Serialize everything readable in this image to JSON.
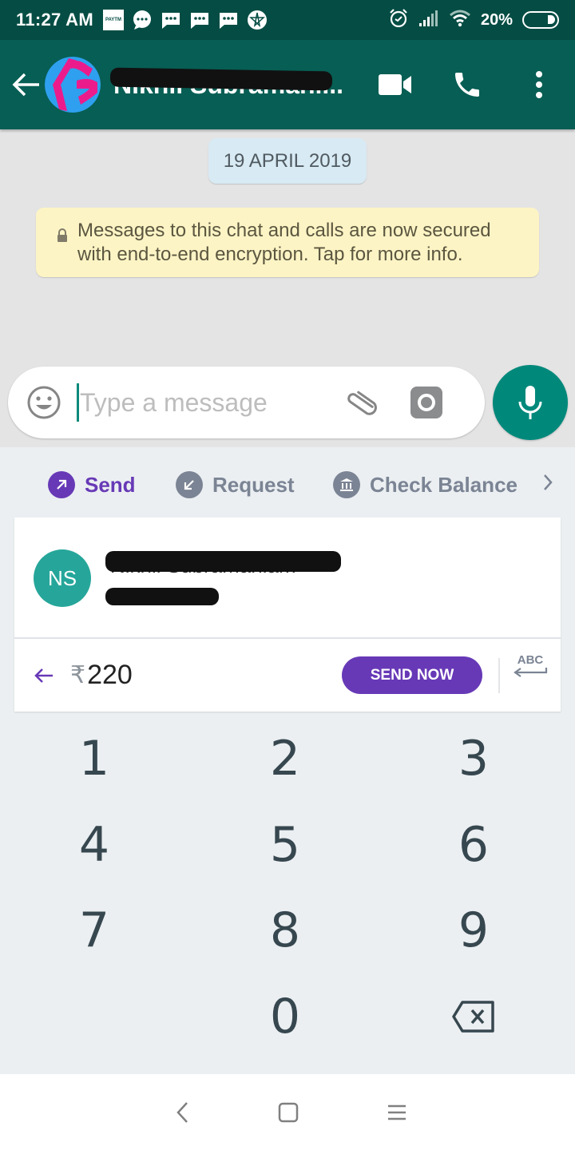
{
  "status_bar": {
    "time": "11:27 AM",
    "notification_icons": [
      "paytm-icon",
      "chat-bubble-icon",
      "message-icon",
      "message-icon",
      "message-icon",
      "star-app-icon"
    ],
    "paytm_label": "PAYTM",
    "battery_percent": "20%",
    "battery_level": 0.2
  },
  "app_bar": {
    "contact_name": "Nikhil Subramani...",
    "contact_name_redacted": true
  },
  "chat": {
    "date_chip": "19 APRIL 2019",
    "encryption_notice": "Messages to this chat and calls are now secured with end-to-end encryption. Tap for more info."
  },
  "composer": {
    "placeholder": "Type a message",
    "value": ""
  },
  "payments": {
    "tabs": [
      {
        "label": "Send",
        "active": true
      },
      {
        "label": "Request",
        "active": false
      },
      {
        "label": "Check Balance",
        "active": false
      }
    ],
    "recipient": {
      "initials": "NS",
      "name": "Nikhil Subramaniam",
      "name_redacted": true,
      "subtitle_redacted": true
    },
    "currency_symbol": "₹",
    "amount": "220",
    "send_now_label": "SEND NOW",
    "keyboard_toggle_label": "ABC",
    "accent_color": "#6739b6"
  },
  "numpad": {
    "keys": [
      "1",
      "2",
      "3",
      "4",
      "5",
      "6",
      "7",
      "8",
      "9",
      "",
      "0",
      "backspace"
    ]
  },
  "colors": {
    "whatsapp_dark": "#054d44",
    "whatsapp_primary": "#075e54",
    "mic_button": "#00897b",
    "payment_purple": "#6739b6",
    "recipient_avatar": "#26a69a"
  }
}
